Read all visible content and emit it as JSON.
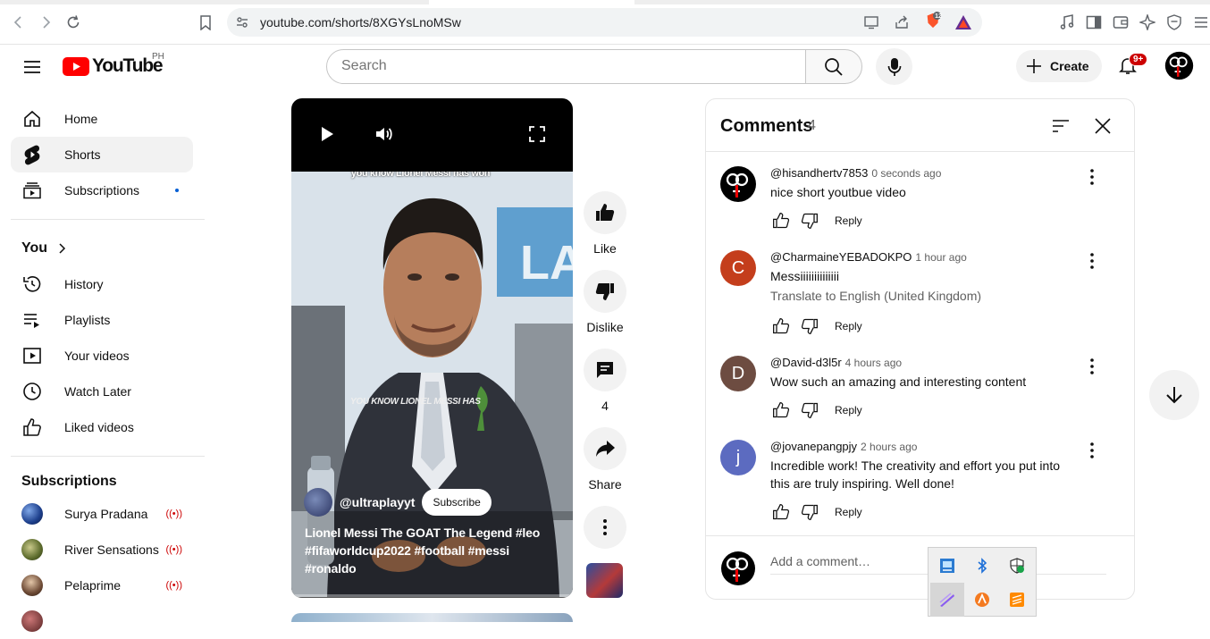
{
  "browser": {
    "url": "youtube.com/shorts/8XGYsLnoMSw",
    "shield_count": "12"
  },
  "header": {
    "logo_text": "YouTube",
    "country_code": "PH",
    "search_placeholder": "Search",
    "create_label": "Create",
    "notifications_badge": "9+"
  },
  "sidebar": {
    "nav": [
      {
        "label": "Home",
        "icon": "home-icon"
      },
      {
        "label": "Shorts",
        "icon": "shorts-icon"
      },
      {
        "label": "Subscriptions",
        "icon": "subscriptions-icon"
      }
    ],
    "you_title": "You",
    "you_items": [
      {
        "label": "History",
        "icon": "history-icon"
      },
      {
        "label": "Playlists",
        "icon": "playlists-icon"
      },
      {
        "label": "Your videos",
        "icon": "your-videos-icon"
      },
      {
        "label": "Watch Later",
        "icon": "clock-icon"
      },
      {
        "label": "Liked videos",
        "icon": "thumbs-up-icon"
      }
    ],
    "subscriptions_title": "Subscriptions",
    "subscriptions": [
      {
        "name": "Surya Pradana",
        "live": "((•))"
      },
      {
        "name": "River Sensations",
        "live": "((•))"
      },
      {
        "name": "Pelaprime",
        "live": "((•))"
      }
    ]
  },
  "short": {
    "caption_top": "you know Lionel Messi has won",
    "caption_mid": "YOU KNOW LIONEL MESSI HAS",
    "channel_handle": "@ultraplayyt",
    "subscribe_label": "Subscribe",
    "title": "Lionel Messi The GOAT The Legend #leo #fifaworldcup2022 #football #messi #ronaldo"
  },
  "actions": {
    "like_label": "Like",
    "dislike_label": "Dislike",
    "comments_count": "4",
    "share_label": "Share"
  },
  "comments": {
    "title": "Comments",
    "count": "4",
    "items": [
      {
        "author": "@hisandhertv7853",
        "time": "0 seconds ago",
        "text": "nice short youtbue video",
        "avatar_letter": "",
        "avatar_color": "#000000",
        "translate": ""
      },
      {
        "author": "@CharmaineYEBADOKPO",
        "time": "1 hour ago",
        "text": "Messiiiiiiiiiiiiii",
        "avatar_letter": "C",
        "avatar_color": "#c43e1c",
        "translate": "Translate to English (United Kingdom)"
      },
      {
        "author": "@David-d3l5r",
        "time": "4 hours ago",
        "text": "Wow such an amazing and interesting content",
        "avatar_letter": "D",
        "avatar_color": "#6d4c41",
        "translate": ""
      },
      {
        "author": "@jovanepangpjy",
        "time": "2 hours ago",
        "text": "Incredible work! The creativity and effort you put into this are truly inspiring. Well done!",
        "avatar_letter": "j",
        "avatar_color": "#5c6bc0",
        "translate": ""
      }
    ],
    "reply_label": "Reply",
    "add_placeholder": "Add a comment…"
  },
  "colors": {
    "youtube_red": "#ff0000",
    "notification_red": "#cc0000",
    "live_red": "#cc0000"
  }
}
